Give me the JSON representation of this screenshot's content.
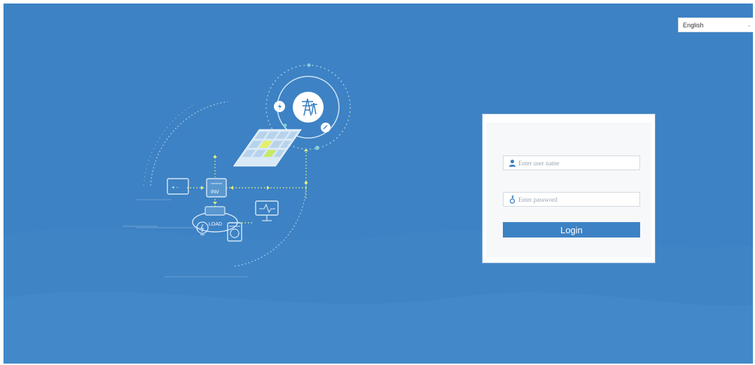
{
  "language": {
    "selected": "English"
  },
  "login": {
    "username_placeholder": "Enter user name",
    "password_placeholder": "Enter password",
    "button_label": "Login"
  },
  "illustration": {
    "inverter_label": "INV",
    "load_label": "LOAD",
    "battery_label": "+ -"
  },
  "colors": {
    "background": "#3d82c4",
    "button": "#3d82c4",
    "accent_dots": "#c8e86a"
  }
}
